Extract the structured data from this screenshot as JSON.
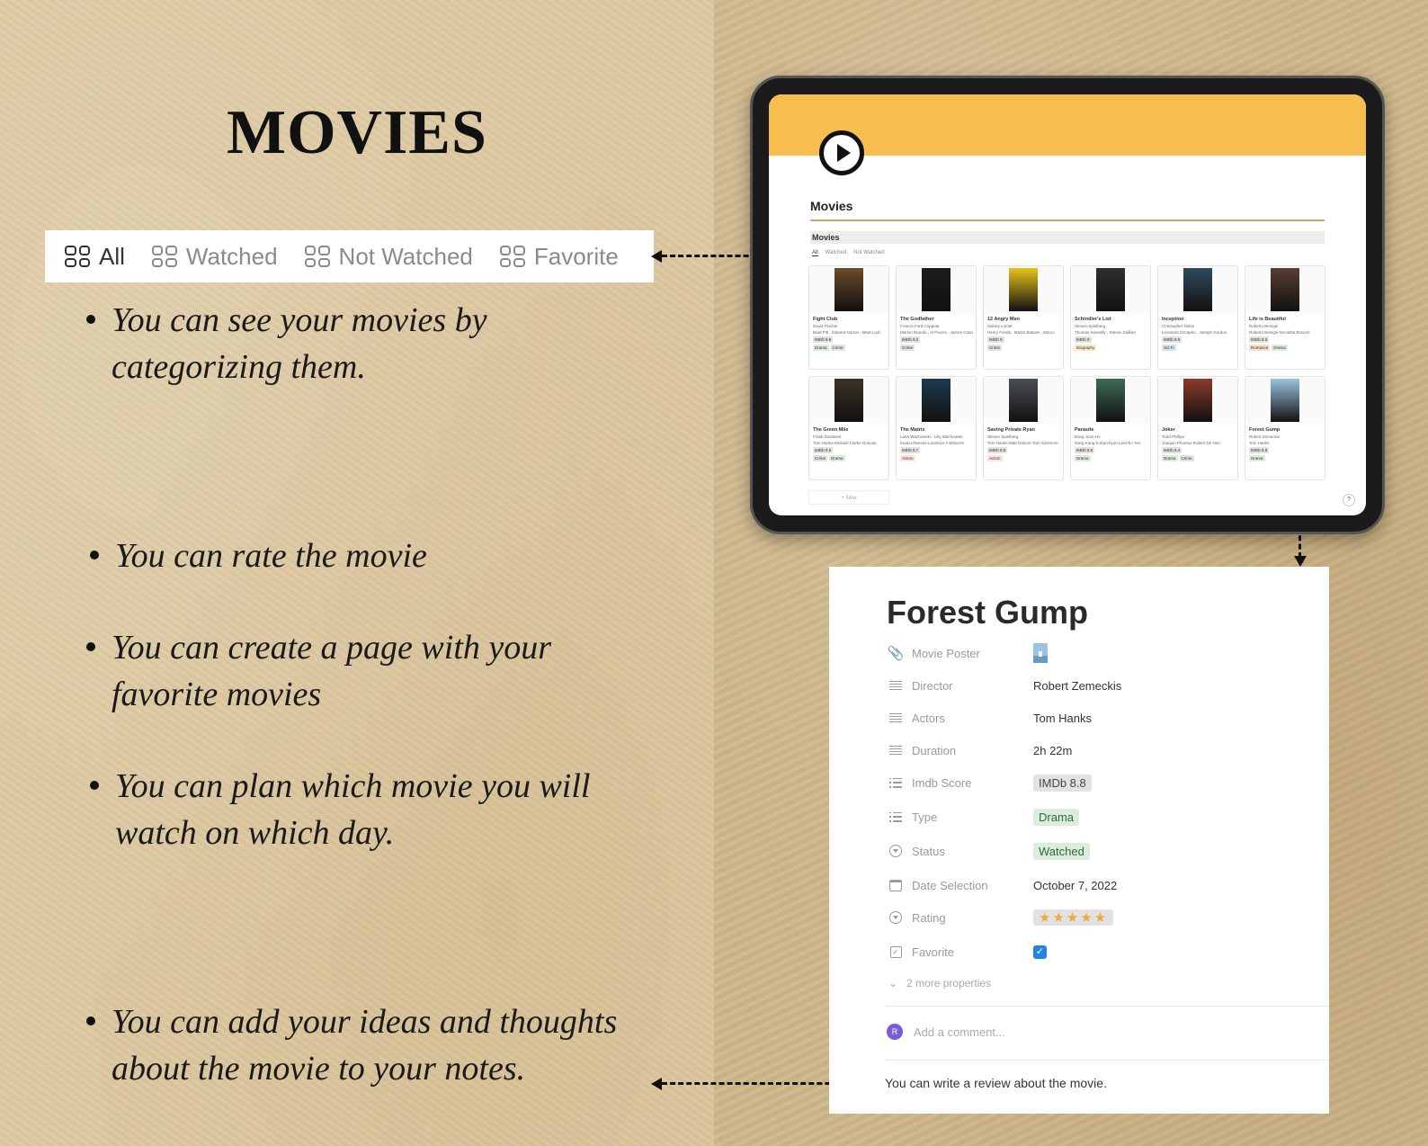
{
  "title": "MOVIES",
  "filter_tabs": [
    {
      "label": "All",
      "active": true
    },
    {
      "label": "Watched",
      "active": false
    },
    {
      "label": "Not Watched",
      "active": false
    },
    {
      "label": "Favorite",
      "active": false
    }
  ],
  "bullets": [
    {
      "line1": "You can see your movies by",
      "line2": "categorizing them."
    },
    {
      "line1": "You can rate the movie",
      "line2": ""
    },
    {
      "line1": "You can create a page with your",
      "line2": "favorite movies"
    },
    {
      "line1": "You can plan which movie you will",
      "line2": "watch on which day."
    },
    {
      "line1": "You can add your ideas and thoughts",
      "line2": "about the movie to your notes."
    }
  ],
  "tablet": {
    "page_title": "Movies",
    "db_title": "Movies",
    "tabs": [
      "All",
      "Watched",
      "Not Watched"
    ],
    "new_label": "+ New",
    "help_label": "?",
    "cards": [
      {
        "title": "Fight Club",
        "director": "David Fincher",
        "actors": "Brad Pitt , Edward Norton , Meat Loaf",
        "imdb": "IMDb 8.8",
        "tags": [
          "Drama",
          "Crime"
        ],
        "poster_color": "#6a4b2e"
      },
      {
        "title": "The Godfather",
        "director": "Francis Ford Coppola",
        "actors": "Marlon Brando , Al Pacino , James Caan",
        "imdb": "IMDb 9.2",
        "tags": [
          "Crime"
        ],
        "poster_color": "#1c1c1c"
      },
      {
        "title": "12 Angry Men",
        "director": "Sidney Lumet",
        "actors": "Henry Fonda , Martin Balsam , Marco",
        "imdb": "IMDb 9",
        "tags": [
          "Crime"
        ],
        "poster_color": "#e8c21a"
      },
      {
        "title": "Schindler's List",
        "director": "Steven Spielberg",
        "actors": "Thomas Keneally , Steven Zaillian",
        "imdb": "IMDb 9",
        "tags": [
          "Biography"
        ],
        "poster_color": "#2e2e2e"
      },
      {
        "title": "Inception",
        "director": "Christopher Nolan",
        "actors": "Leonardo DiCaprio , Joseph Gordon",
        "imdb": "IMDb 8.8",
        "tags": [
          "Sci-Fi"
        ],
        "poster_color": "#2f4a5c"
      },
      {
        "title": "Life is Beautiful",
        "director": "Roberto Benigni",
        "actors": "Roberto Benigni-Nicoletta Braschi",
        "imdb": "IMDb 8.6",
        "tags": [
          "Romance",
          "Drama"
        ],
        "poster_color": "#5a3e34"
      },
      {
        "title": "The Green Mile",
        "director": "Frank Darabont",
        "actors": "Tom Hanks-Michael Clarke Duncan",
        "imdb": "IMDb 8.6",
        "tags": [
          "Crime",
          "Drama"
        ],
        "poster_color": "#3b3327"
      },
      {
        "title": "The Matrix",
        "director": "Lana Wachowski - Lilly Wachowski",
        "actors": "Keanu Reeves-Laurence Fishburne",
        "imdb": "IMDb 8.7",
        "tags": [
          "Action"
        ],
        "poster_color": "#1e3a4f"
      },
      {
        "title": "Saving Private Ryan",
        "director": "Steven Spielberg",
        "actors": "Tom Hanks-Matt Damon-Tom Sizemore",
        "imdb": "IMDb 8.6",
        "tags": [
          "Action"
        ],
        "poster_color": "#4a4f52"
      },
      {
        "title": "Parasite",
        "director": "Bong Joon Ho",
        "actors": "Song Kang-hoSun-kyun LeeCho Yeo",
        "imdb": "IMDb 8.5",
        "tags": [
          "Drama"
        ],
        "poster_color": "#3e6b55"
      },
      {
        "title": "Joker",
        "director": "Todd Phillips",
        "actors": "Joaquin Phoenix-Robert De Niro",
        "imdb": "IMDb 8.4",
        "tags": [
          "Drama",
          "Crime"
        ],
        "poster_color": "#8c3a2a"
      },
      {
        "title": "Forest Gump",
        "director": "Robert Zemeckis",
        "actors": "Tom Hanks",
        "imdb": "IMDb 8.8",
        "tags": [
          "Drama"
        ],
        "poster_color": "#9cc3e0"
      }
    ]
  },
  "tag_colors": {
    "Drama": "#dbeddb",
    "Crime": "#e3e2e0",
    "Biography": "#fdecc8",
    "Sci-Fi": "#d3e5ef",
    "Romance": "#fadec9",
    "Action": "#ffe2dd"
  },
  "detail": {
    "title": "Forest Gump",
    "props": {
      "poster": "Movie Poster",
      "director": "Director",
      "actors": "Actors",
      "duration": "Duration",
      "imdb": "Imdb Score",
      "type": "Type",
      "status": "Status",
      "date": "Date Selection",
      "rating": "Rating",
      "favorite": "Favorite"
    },
    "values": {
      "director": "Robert Zemeckis",
      "actors": "Tom Hanks",
      "duration": "2h 22m",
      "imdb": "IMDb 8.8",
      "type": "Drama",
      "status": "Watched",
      "date": "October 7, 2022",
      "rating_stars": "★★★★★",
      "favorite": true
    },
    "more_properties": "2 more properties",
    "comment_placeholder": "Add a comment...",
    "avatar_initial": "R",
    "review": "You can write a review about the movie."
  }
}
